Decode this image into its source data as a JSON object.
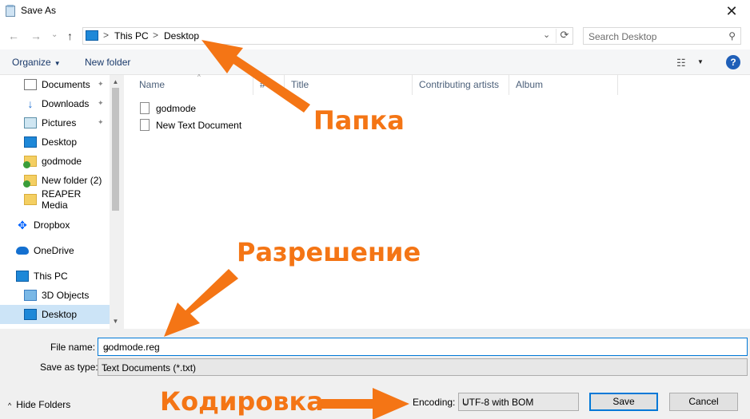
{
  "window": {
    "title": "Save As",
    "close_glyph": "✕"
  },
  "navigation": {
    "back_glyph": "←",
    "forward_glyph": "→",
    "recent_glyph": "⌄",
    "up_glyph": "↑",
    "breadcrumb": [
      "This PC",
      "Desktop"
    ],
    "crumb_separator": ">",
    "dropdown_glyph": "⌄",
    "refresh_glyph": "⟳",
    "search_placeholder": "Search Desktop",
    "search_glyph": "⚲"
  },
  "toolbar": {
    "organize_label": "Organize",
    "new_folder_label": "New folder",
    "view_glyph": "☷",
    "help_glyph": "?"
  },
  "sidebar": {
    "items": [
      {
        "label": "Documents",
        "icon": "document-icon",
        "pinned": true
      },
      {
        "label": "Downloads",
        "icon": "download-icon",
        "pinned": true
      },
      {
        "label": "Pictures",
        "icon": "pictures-icon",
        "pinned": true
      },
      {
        "label": "Desktop",
        "icon": "desktop-icon",
        "pinned": false
      },
      {
        "label": "godmode",
        "icon": "folder-synced-icon",
        "pinned": false
      },
      {
        "label": "New folder (2)",
        "icon": "folder-synced-icon",
        "pinned": false
      },
      {
        "label": "REAPER Media",
        "icon": "folder-icon",
        "pinned": false
      },
      {
        "label": "Dropbox",
        "icon": "dropbox-icon",
        "pinned": false
      },
      {
        "label": "OneDrive",
        "icon": "onedrive-icon",
        "pinned": false
      },
      {
        "label": "This PC",
        "icon": "this-pc-icon",
        "pinned": false
      },
      {
        "label": "3D Objects",
        "icon": "3d-objects-icon",
        "pinned": false
      },
      {
        "label": "Desktop",
        "icon": "desktop-icon",
        "pinned": false,
        "selected": true
      }
    ],
    "pin_glyph": "📌",
    "scroll_up_glyph": "▲",
    "scroll_down_glyph": "▼"
  },
  "file_list": {
    "columns": [
      "Name",
      "#",
      "Title",
      "Contributing artists",
      "Album"
    ],
    "sort_glyph": "^",
    "files": [
      "godmode",
      "New Text Document"
    ]
  },
  "form": {
    "file_name_label": "File name:",
    "file_name_value": "godmode.reg",
    "save_type_label": "Save as type:",
    "save_type_value": "Text Documents (*.txt)",
    "encoding_label": "Encoding:",
    "encoding_value": "UTF-8 with BOM",
    "combo_glyph": "⌄",
    "hide_folders_label": "Hide Folders",
    "hide_folders_glyph": "^",
    "save_label": "Save",
    "cancel_label": "Cancel"
  },
  "annotations": {
    "folder": "Папка",
    "extension": "Разрешение",
    "encoding": "Кодировка",
    "color": "#f47515"
  },
  "colors": {
    "accent": "#0078d7",
    "selection": "#cce4f7",
    "annotation": "#f47515"
  }
}
